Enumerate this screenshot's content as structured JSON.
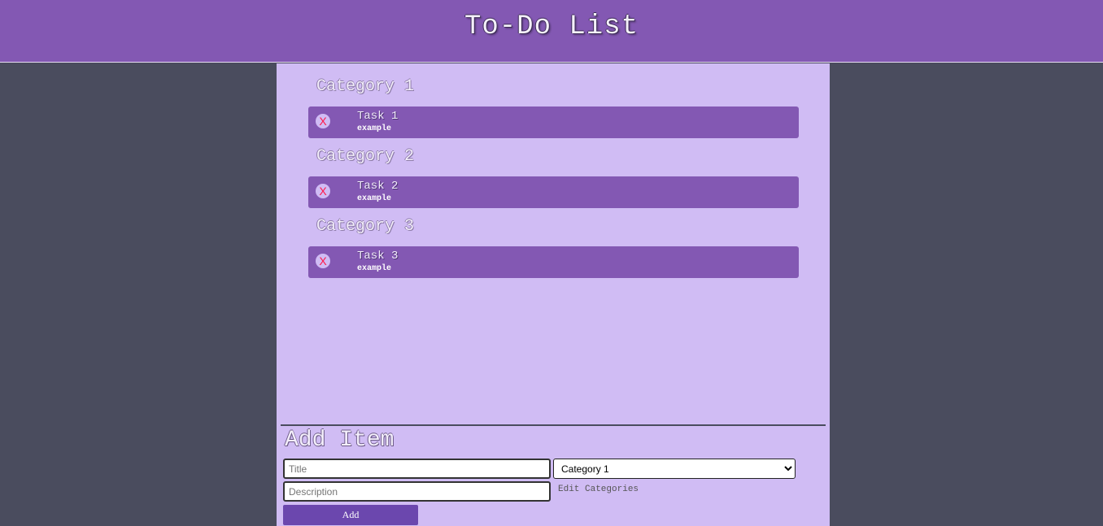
{
  "header": {
    "title": "To-Do List"
  },
  "categories": [
    {
      "name": "Category 1",
      "tasks": [
        {
          "delete_label": "X",
          "title": "Task 1",
          "description": "example"
        }
      ]
    },
    {
      "name": "Category 2",
      "tasks": [
        {
          "delete_label": "X",
          "title": "Task 2",
          "description": "example"
        }
      ]
    },
    {
      "name": "Category 3",
      "tasks": [
        {
          "delete_label": "X",
          "title": "Task 3",
          "description": "example"
        }
      ]
    }
  ],
  "add_form": {
    "heading": "Add Item",
    "title_placeholder": "Title",
    "description_placeholder": "Description",
    "category_selected": "Category 1",
    "edit_categories_label": "Edit Categories",
    "add_button_label": "Add"
  },
  "colors": {
    "header": "#8358b3",
    "panel": "#d0bcf4",
    "task": "#8358b3",
    "page_background": "#4a4c5e",
    "delete_icon": "#ff1a4a",
    "add_button": "#6b47ae"
  },
  "icons": {
    "delete": "close-x-icon"
  }
}
